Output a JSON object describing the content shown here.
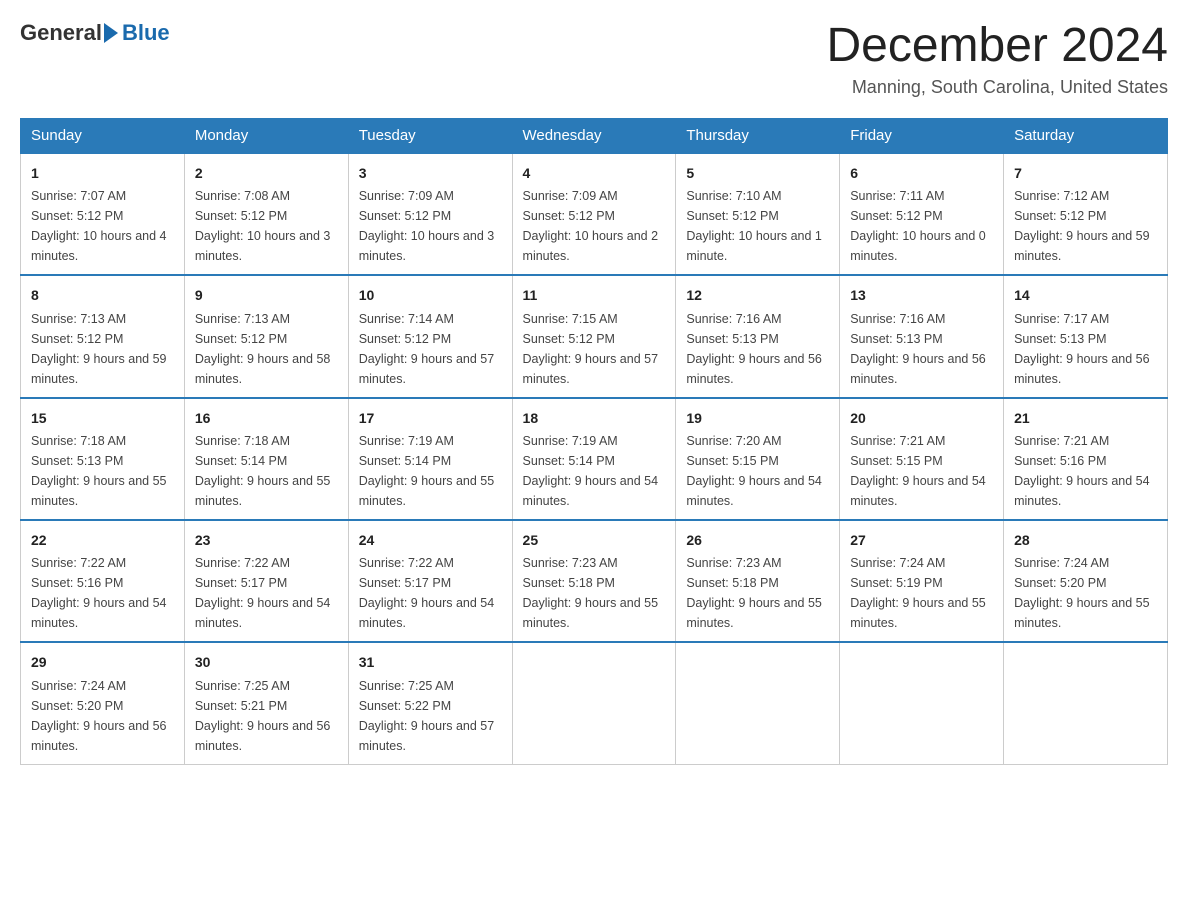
{
  "header": {
    "logo_general": "General",
    "logo_blue": "Blue",
    "title": "December 2024",
    "location": "Manning, South Carolina, United States"
  },
  "days_of_week": [
    "Sunday",
    "Monday",
    "Tuesday",
    "Wednesday",
    "Thursday",
    "Friday",
    "Saturday"
  ],
  "weeks": [
    [
      {
        "day": "1",
        "sunrise": "7:07 AM",
        "sunset": "5:12 PM",
        "daylight": "10 hours and 4 minutes."
      },
      {
        "day": "2",
        "sunrise": "7:08 AM",
        "sunset": "5:12 PM",
        "daylight": "10 hours and 3 minutes."
      },
      {
        "day": "3",
        "sunrise": "7:09 AM",
        "sunset": "5:12 PM",
        "daylight": "10 hours and 3 minutes."
      },
      {
        "day": "4",
        "sunrise": "7:09 AM",
        "sunset": "5:12 PM",
        "daylight": "10 hours and 2 minutes."
      },
      {
        "day": "5",
        "sunrise": "7:10 AM",
        "sunset": "5:12 PM",
        "daylight": "10 hours and 1 minute."
      },
      {
        "day": "6",
        "sunrise": "7:11 AM",
        "sunset": "5:12 PM",
        "daylight": "10 hours and 0 minutes."
      },
      {
        "day": "7",
        "sunrise": "7:12 AM",
        "sunset": "5:12 PM",
        "daylight": "9 hours and 59 minutes."
      }
    ],
    [
      {
        "day": "8",
        "sunrise": "7:13 AM",
        "sunset": "5:12 PM",
        "daylight": "9 hours and 59 minutes."
      },
      {
        "day": "9",
        "sunrise": "7:13 AM",
        "sunset": "5:12 PM",
        "daylight": "9 hours and 58 minutes."
      },
      {
        "day": "10",
        "sunrise": "7:14 AM",
        "sunset": "5:12 PM",
        "daylight": "9 hours and 57 minutes."
      },
      {
        "day": "11",
        "sunrise": "7:15 AM",
        "sunset": "5:12 PM",
        "daylight": "9 hours and 57 minutes."
      },
      {
        "day": "12",
        "sunrise": "7:16 AM",
        "sunset": "5:13 PM",
        "daylight": "9 hours and 56 minutes."
      },
      {
        "day": "13",
        "sunrise": "7:16 AM",
        "sunset": "5:13 PM",
        "daylight": "9 hours and 56 minutes."
      },
      {
        "day": "14",
        "sunrise": "7:17 AM",
        "sunset": "5:13 PM",
        "daylight": "9 hours and 56 minutes."
      }
    ],
    [
      {
        "day": "15",
        "sunrise": "7:18 AM",
        "sunset": "5:13 PM",
        "daylight": "9 hours and 55 minutes."
      },
      {
        "day": "16",
        "sunrise": "7:18 AM",
        "sunset": "5:14 PM",
        "daylight": "9 hours and 55 minutes."
      },
      {
        "day": "17",
        "sunrise": "7:19 AM",
        "sunset": "5:14 PM",
        "daylight": "9 hours and 55 minutes."
      },
      {
        "day": "18",
        "sunrise": "7:19 AM",
        "sunset": "5:14 PM",
        "daylight": "9 hours and 54 minutes."
      },
      {
        "day": "19",
        "sunrise": "7:20 AM",
        "sunset": "5:15 PM",
        "daylight": "9 hours and 54 minutes."
      },
      {
        "day": "20",
        "sunrise": "7:21 AM",
        "sunset": "5:15 PM",
        "daylight": "9 hours and 54 minutes."
      },
      {
        "day": "21",
        "sunrise": "7:21 AM",
        "sunset": "5:16 PM",
        "daylight": "9 hours and 54 minutes."
      }
    ],
    [
      {
        "day": "22",
        "sunrise": "7:22 AM",
        "sunset": "5:16 PM",
        "daylight": "9 hours and 54 minutes."
      },
      {
        "day": "23",
        "sunrise": "7:22 AM",
        "sunset": "5:17 PM",
        "daylight": "9 hours and 54 minutes."
      },
      {
        "day": "24",
        "sunrise": "7:22 AM",
        "sunset": "5:17 PM",
        "daylight": "9 hours and 54 minutes."
      },
      {
        "day": "25",
        "sunrise": "7:23 AM",
        "sunset": "5:18 PM",
        "daylight": "9 hours and 55 minutes."
      },
      {
        "day": "26",
        "sunrise": "7:23 AM",
        "sunset": "5:18 PM",
        "daylight": "9 hours and 55 minutes."
      },
      {
        "day": "27",
        "sunrise": "7:24 AM",
        "sunset": "5:19 PM",
        "daylight": "9 hours and 55 minutes."
      },
      {
        "day": "28",
        "sunrise": "7:24 AM",
        "sunset": "5:20 PM",
        "daylight": "9 hours and 55 minutes."
      }
    ],
    [
      {
        "day": "29",
        "sunrise": "7:24 AM",
        "sunset": "5:20 PM",
        "daylight": "9 hours and 56 minutes."
      },
      {
        "day": "30",
        "sunrise": "7:25 AM",
        "sunset": "5:21 PM",
        "daylight": "9 hours and 56 minutes."
      },
      {
        "day": "31",
        "sunrise": "7:25 AM",
        "sunset": "5:22 PM",
        "daylight": "9 hours and 57 minutes."
      },
      null,
      null,
      null,
      null
    ]
  ]
}
